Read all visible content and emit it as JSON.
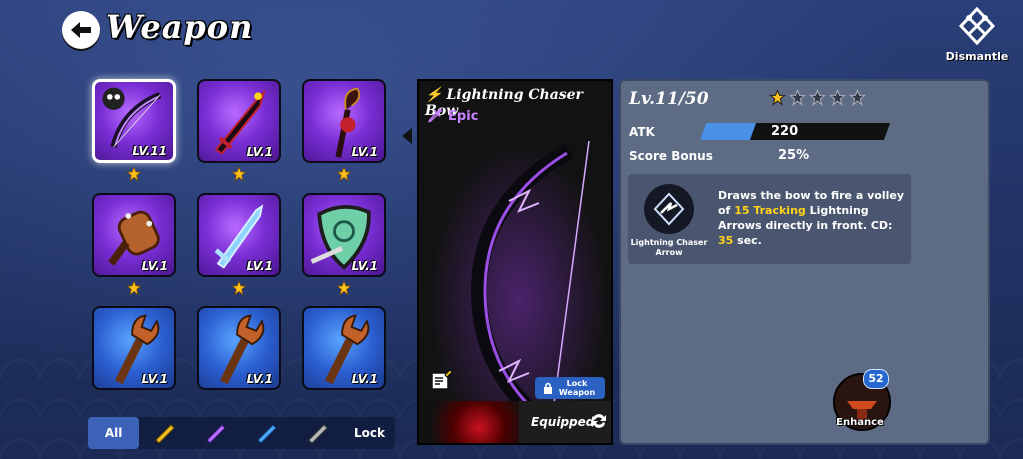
{
  "header": {
    "title": "Weapon",
    "dismantle_label": "Dismantle"
  },
  "inventory": {
    "items": [
      {
        "level": "LV.11",
        "rarity": "epic",
        "star": true,
        "selected": true
      },
      {
        "level": "LV.1",
        "rarity": "epic",
        "star": true
      },
      {
        "level": "LV.1",
        "rarity": "epic",
        "star": true
      },
      {
        "level": "LV.1",
        "rarity": "epic",
        "star": true
      },
      {
        "level": "LV.1",
        "rarity": "epic",
        "star": true
      },
      {
        "level": "LV.1",
        "rarity": "epic",
        "star": true
      },
      {
        "level": "LV.1",
        "rarity": "rare",
        "star": false
      },
      {
        "level": "LV.1",
        "rarity": "rare",
        "star": false
      },
      {
        "level": "LV.1",
        "rarity": "rare",
        "star": false
      }
    ]
  },
  "filters": {
    "all": "All",
    "lock": "Lock"
  },
  "weapon": {
    "name": "Lightning Chaser Bow",
    "rarity": "Epic",
    "lock_label": "Lock Weapon",
    "equipped_label": "Equipped"
  },
  "stats": {
    "level": "Lv.11/50",
    "stars_filled": 1,
    "stars_total": 5,
    "atk_label": "ATK",
    "atk_value": "220",
    "atk_fill_fraction": 0.27,
    "score_label": "Score Bonus",
    "score_value": "25%"
  },
  "skill": {
    "name": "Lightning Chaser Arrow",
    "desc_1": "Draws the bow to fire a volley of ",
    "desc_hl1": "15 Tracking",
    "desc_2": " Lightning Arrows directly in front. CD: ",
    "desc_hl2": "35",
    "desc_3": " sec."
  },
  "enhance": {
    "label": "Enhance",
    "count": "52"
  },
  "colors": {
    "epic": "#7a2fd6",
    "rare": "#2b5fd1",
    "highlight": "#ffd21a",
    "panel": "#5e6b84"
  }
}
